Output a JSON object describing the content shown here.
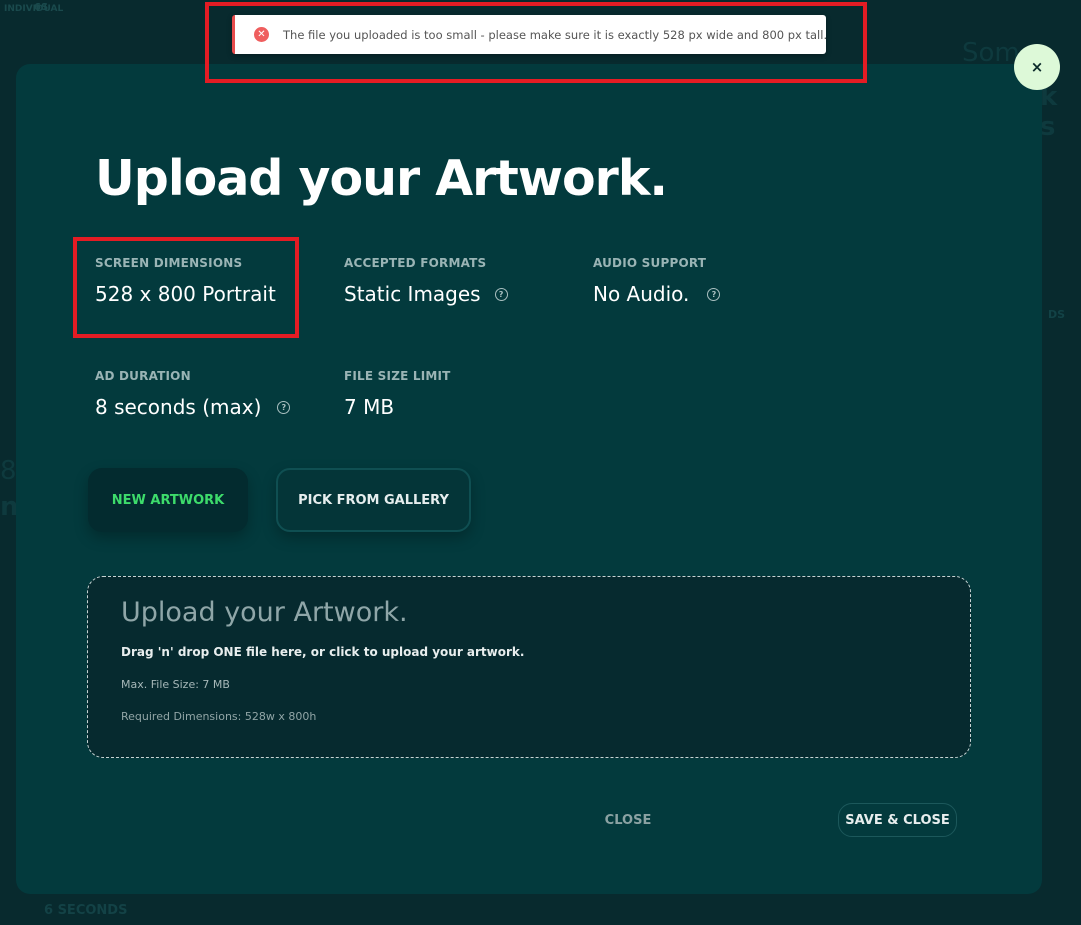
{
  "background": {
    "top_a": "INDIVIDUAL",
    "top_b": "6S",
    "right_title": "Som",
    "right_title2": "k s",
    "left_8": "8",
    "left_n": "n",
    "bottom": "6 SECONDS",
    "right_small": "DS"
  },
  "toast": {
    "icon": "error-icon",
    "message": "The file you uploaded is too small - please make sure it is exactly 528 px wide and 800 px tall."
  },
  "modal": {
    "close_icon_glyph": "×",
    "title": "Upload your Artwork.",
    "specs": {
      "screen_dimensions": {
        "label": "SCREEN DIMENSIONS",
        "value": "528 x 800 Portrait"
      },
      "accepted_formats": {
        "label": "ACCEPTED FORMATS",
        "value": "Static Images"
      },
      "audio_support": {
        "label": "AUDIO SUPPORT",
        "value": "No Audio."
      },
      "ad_duration": {
        "label": "AD DURATION",
        "value": "8 seconds (max)"
      },
      "file_size_limit": {
        "label": "FILE SIZE LIMIT",
        "value": "7 MB"
      }
    },
    "buttons": {
      "new_artwork": "NEW ARTWORK",
      "pick_from_gallery": "PICK FROM GALLERY"
    },
    "dropzone": {
      "title": "Upload your Artwork.",
      "instruction": "Drag 'n' drop ONE file here, or click to upload your artwork.",
      "max_size": "Max. File Size: 7 MB",
      "required_dimensions": "Required Dimensions: 528w x 800h"
    },
    "footer": {
      "close": "CLOSE",
      "save_close": "SAVE & CLOSE"
    }
  },
  "colors": {
    "modal_bg": "#033a3d",
    "accent_green": "#3ddc6b",
    "highlight_red": "#e41c24",
    "error_red": "#ef5e5e"
  }
}
